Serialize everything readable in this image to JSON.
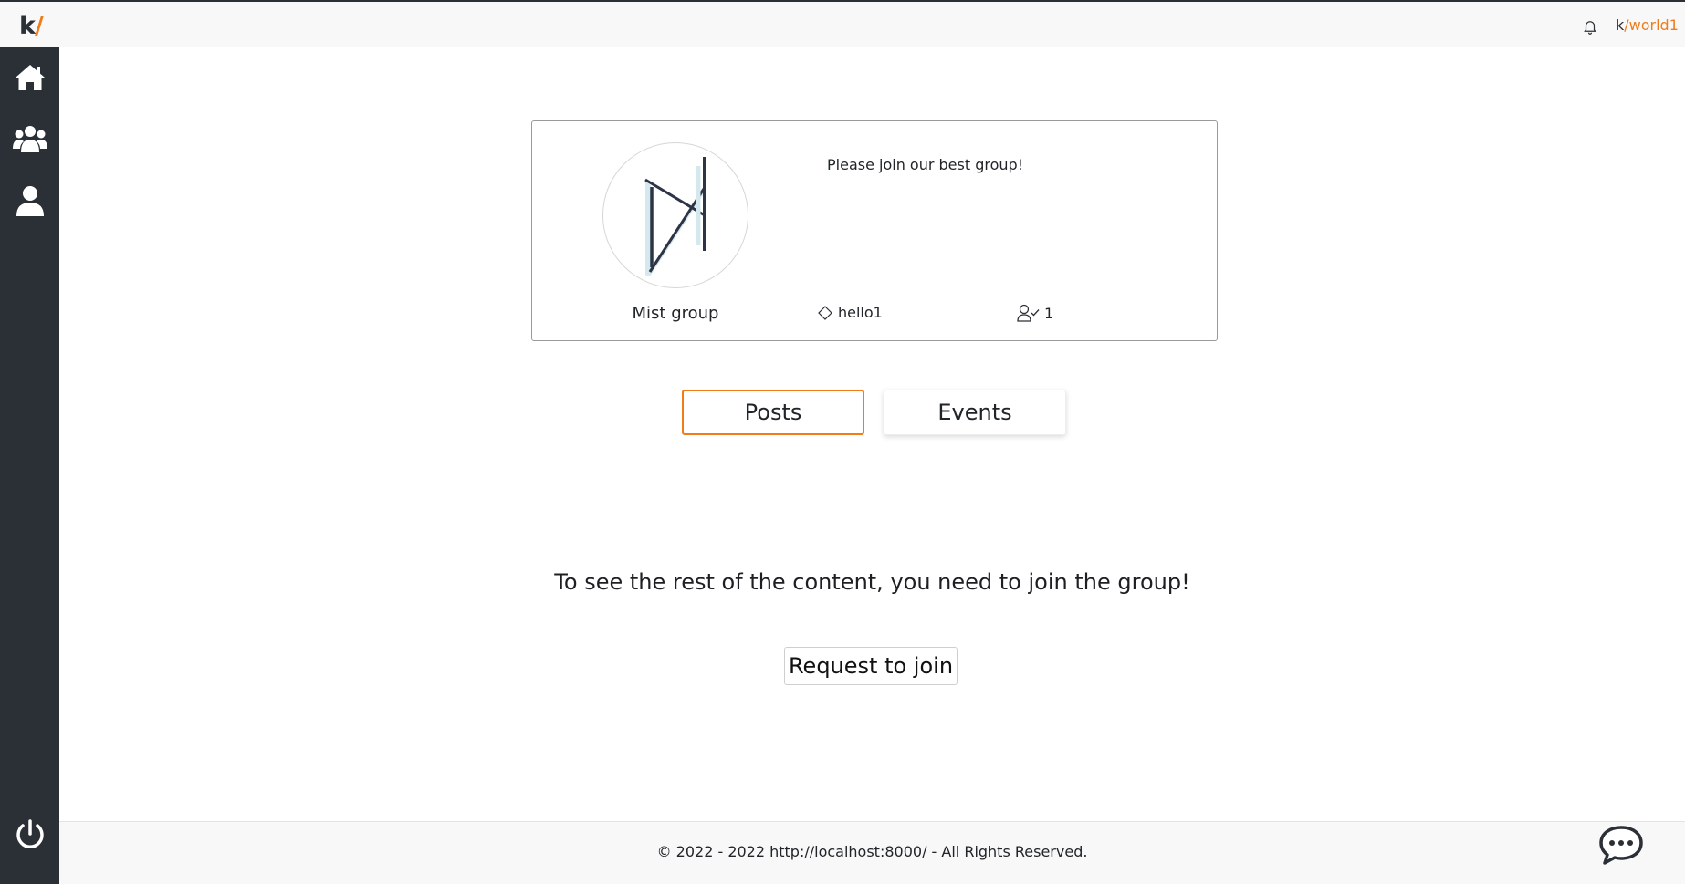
{
  "app": {
    "logo_k": "k",
    "logo_slash": "/"
  },
  "header": {
    "user_prefix": "k",
    "user_rest": "/world1",
    "icons": {
      "notifications": "bell-icon"
    }
  },
  "sidebar": {
    "items": [
      {
        "icon": "home-icon"
      },
      {
        "icon": "groups-icon"
      },
      {
        "icon": "profile-icon"
      }
    ],
    "logout_icon": "power-icon"
  },
  "group": {
    "name": "Mist group",
    "description": "Please join our best group!",
    "tag": "hello1",
    "member_count": "1"
  },
  "tabs": {
    "posts": "Posts",
    "events": "Events",
    "active": "Posts"
  },
  "join": {
    "message": "To see the rest of the content, you need to join the group!",
    "button": "Request to join"
  },
  "footer": {
    "text": "© 2022 - 2022 http://localhost:8000/ - All Rights Reserved."
  },
  "colors": {
    "accent": "#f07c1a",
    "sidebar": "#2b2f36",
    "topbar": "#f8f8f8"
  }
}
